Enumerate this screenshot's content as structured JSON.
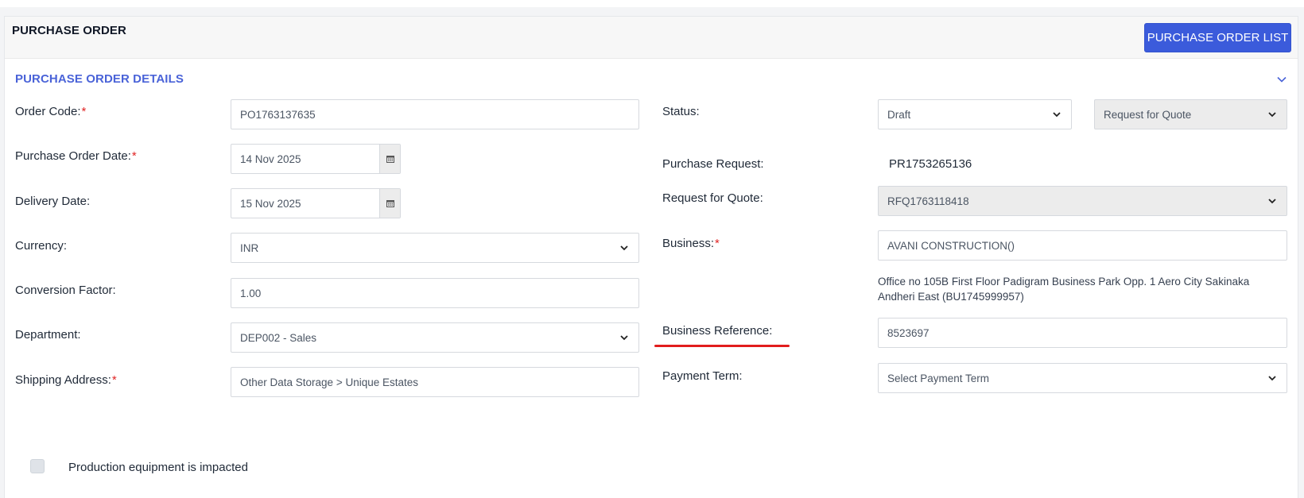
{
  "header": {
    "title": "PURCHASE ORDER",
    "list_button": "PURCHASE ORDER LIST"
  },
  "section": {
    "title": "PURCHASE ORDER DETAILS"
  },
  "left": {
    "order_code": {
      "label": "Order Code:",
      "required": "*",
      "value": "PO1763137635"
    },
    "po_date": {
      "label": "Purchase Order Date:",
      "required": "*",
      "value": "14 Nov 2025"
    },
    "delivery_date": {
      "label": "Delivery Date:",
      "value": "15 Nov 2025"
    },
    "currency": {
      "label": "Currency:",
      "value": "INR"
    },
    "conversion": {
      "label": "Conversion Factor:",
      "value": "1.00"
    },
    "department": {
      "label": "Department:",
      "value": "DEP002 - Sales"
    },
    "shipping": {
      "label": "Shipping Address:",
      "required": "*",
      "value": "Other Data Storage > Unique Estates"
    }
  },
  "right": {
    "status": {
      "label": "Status:",
      "value": "Draft",
      "secondary_value": "Request for Quote"
    },
    "purchase_request": {
      "label": "Purchase Request:",
      "value": "PR1753265136"
    },
    "rfq": {
      "label": "Request for Quote:",
      "value": "RFQ1763118418"
    },
    "business": {
      "label": "Business:",
      "required": "*",
      "value": "AVANI CONSTRUCTION()",
      "address_line1": "Office no 105B First Floor Padigram Business Park Opp. 1 Aero City Sakinaka",
      "address_line2": "Andheri East (BU1745999957)"
    },
    "business_reference": {
      "label": "Business Reference:",
      "value": "8523697"
    },
    "payment_term": {
      "label": "Payment Term:",
      "placeholder": "Select Payment Term"
    }
  },
  "checkbox": {
    "label": "Production equipment is impacted",
    "checked": false
  },
  "colors": {
    "accent": "#3b5bdb",
    "section_title": "#4a63d8",
    "required": "#e02424",
    "highlight_underline": "#e11d1d"
  },
  "icons": [
    "calendar-icon",
    "chevron-down-icon"
  ]
}
